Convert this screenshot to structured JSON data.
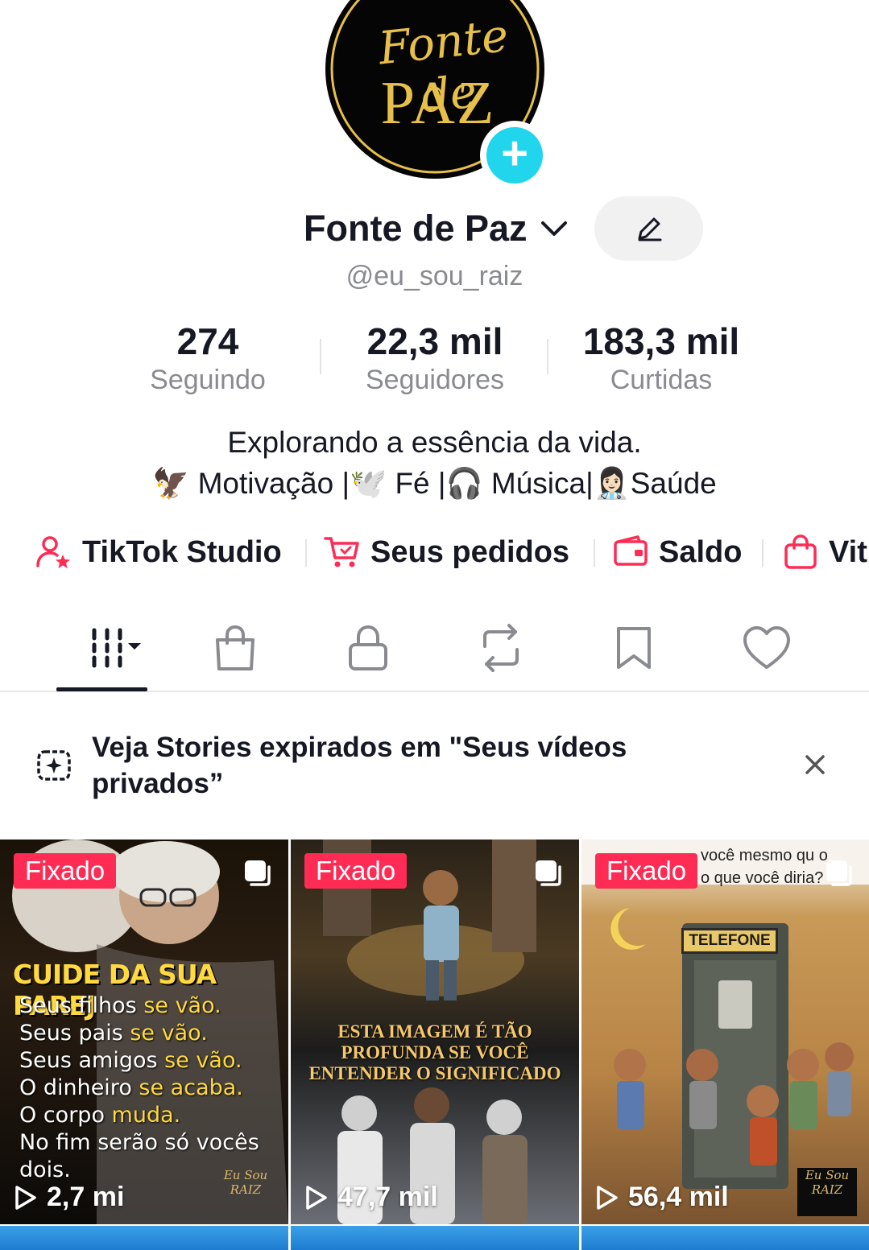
{
  "profile": {
    "logo_line1": "Fonte de",
    "logo_line2": "PAZ",
    "name": "Fonte de Paz",
    "handle": "@eu_sou_raiz"
  },
  "stats": [
    {
      "value": "274",
      "label": "Seguindo"
    },
    {
      "value": "22,3 mil",
      "label": "Seguidores"
    },
    {
      "value": "183,3 mil",
      "label": "Curtidas"
    }
  ],
  "bio": {
    "line1": "Explorando a essência da vida.",
    "line2": "🦅 Motivação |🕊️ Fé |🎧 Música|👩🏻‍⚕️Saúde"
  },
  "shortcuts": [
    {
      "label": "TikTok Studio",
      "icon": "person-star-icon"
    },
    {
      "label": "Seus pedidos",
      "icon": "cart-icon"
    },
    {
      "label": "Saldo",
      "icon": "wallet-icon"
    },
    {
      "label": "Vit",
      "icon": "shopping-bag-icon"
    }
  ],
  "tabs": [
    {
      "icon": "grid-icon",
      "active": true
    },
    {
      "icon": "shop-bag-icon"
    },
    {
      "icon": "lock-icon"
    },
    {
      "icon": "repost-icon"
    },
    {
      "icon": "bookmark-icon"
    },
    {
      "icon": "heart-icon"
    }
  ],
  "banner": {
    "text": "Veja Stories expirados em \"Seus vídeos privados”"
  },
  "videos": [
    {
      "badge": "Fixado",
      "views": "2,7 mi",
      "headline": "CUIDE DA SUA PAREJ",
      "lines": [
        {
          "a": "Seus filhos ",
          "b": "se vão."
        },
        {
          "a": "Seus pais ",
          "b": "se vão."
        },
        {
          "a": "Seus amigos ",
          "b": "se vão."
        },
        {
          "a": "O dinheiro ",
          "b": "se acaba."
        },
        {
          "a": "O corpo ",
          "b": "muda."
        },
        {
          "a": "No fim serão só vocês dois.",
          "b": ""
        }
      ],
      "watermark": "Eu Sou RAIZ"
    },
    {
      "badge": "Fixado",
      "views": "47,7 mil",
      "headline_l1": "ESTA IMAGEM É TÃO",
      "headline_l2": "PROFUNDA SE VOCÊ",
      "headline_l3": "ENTENDER O SIGNIFICADO"
    },
    {
      "badge": "Fixado",
      "views": "56,4 mil",
      "top_l1": "você mesmo qu   o",
      "top_l2": "o que você diria?",
      "sign": "TELEFONE",
      "watermark": "Eu Sou RAIZ"
    }
  ],
  "colors": {
    "accent_red": "#fe2c55",
    "accent_cyan": "#20d5ec",
    "text_primary": "#161823",
    "text_secondary": "#8a8b91",
    "logo_gold": "#e7c04a"
  }
}
